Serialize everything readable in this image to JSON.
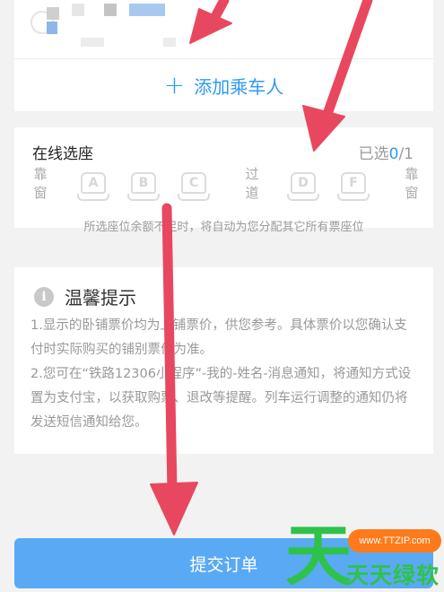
{
  "passenger": {
    "add_label": "添加乘车人"
  },
  "seat_selection": {
    "title": "在线选座",
    "selected_prefix": "已选",
    "selected_count": "0",
    "selected_total": "/1",
    "window_left": "靠窗",
    "aisle": "过道",
    "window_right": "靠窗",
    "seats_left": [
      "A",
      "B",
      "C"
    ],
    "seats_right": [
      "D",
      "F"
    ],
    "note": "所选座位余额不足时，将自动为您分配其它所有票座位"
  },
  "tips": {
    "title": "温馨提示",
    "icon_glyph": "i",
    "line1": "1.显示的卧铺票价均为上铺票价，供您参考。具体票价以您确认支付时实际购买的铺别票价为准。",
    "line2": "2.您可在“铁路12306小程序”-我的-姓名-消息通知，将通知方式设置为支付宝，以获取购票、退改等提醒。列车运行调整的通知仍将发送短信通知给您。"
  },
  "submit": {
    "label": "提交订单"
  },
  "watermark": {
    "big_char": "天",
    "url": "www.TTZIP.com",
    "name": "天天绿软"
  },
  "colors": {
    "accent": "#2c9af4",
    "submit_bg": "#5aa9f5",
    "arrow": "#e8485f",
    "watermark_green": "#2fc24a",
    "watermark_orange": "#ff7a1a"
  }
}
